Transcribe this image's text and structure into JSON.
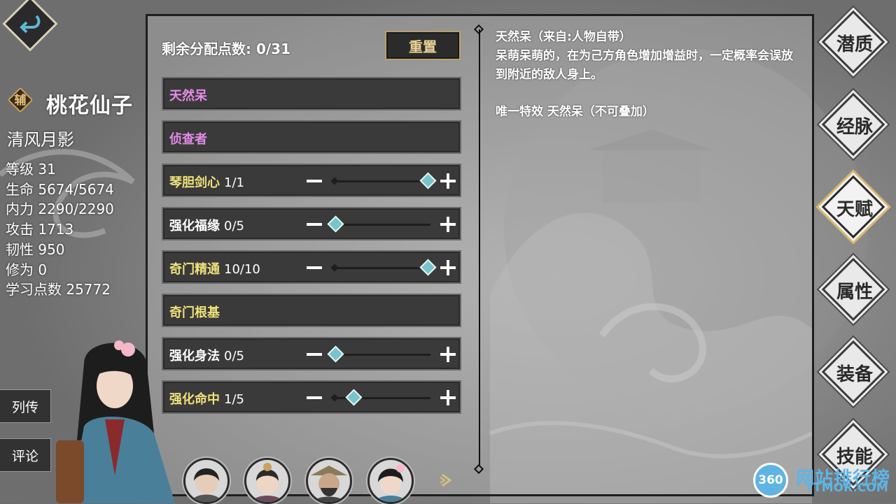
{
  "header": {
    "back_icon": "return-arrow-icon"
  },
  "character": {
    "role_badge": "辅",
    "name": "桃花仙子",
    "title": "清风月影",
    "stats": [
      "等级 31",
      "生命 5674/5674",
      "内力 2290/2290",
      "攻击 1713",
      "韧性 950",
      "修为 0",
      "学习点数 25772"
    ]
  },
  "side_buttons": {
    "biography": "列传",
    "comments": "评论"
  },
  "talent_panel": {
    "remaining_points_label": "剩余分配点数: 0/31",
    "reset_label": "重置",
    "rows": [
      {
        "name": "天然呆",
        "count": "",
        "color": "#e58be8",
        "has_slider": false
      },
      {
        "name": "侦查者",
        "count": "",
        "color": "#e58be8",
        "has_slider": false
      },
      {
        "name": "琴胆剑心",
        "count": "1/1",
        "color": "#eee07b",
        "has_slider": true,
        "level": 1.0
      },
      {
        "name": "强化福缘",
        "count": "0/5",
        "color": "#ffffff",
        "has_slider": true,
        "level": 0.0
      },
      {
        "name": "奇门精通",
        "count": "10/10",
        "color": "#eee07b",
        "has_slider": true,
        "level": 1.0
      },
      {
        "name": "奇门根基",
        "count": "",
        "color": "#eee07b",
        "has_slider": false
      },
      {
        "name": "强化身法",
        "count": "0/5",
        "color": "#ffffff",
        "has_slider": true,
        "level": 0.0
      },
      {
        "name": "强化命中",
        "count": "1/5",
        "color": "#eee07b",
        "has_slider": true,
        "level": 0.2
      }
    ]
  },
  "description": {
    "title": "天然呆（来自:人物自带）",
    "body": "呆萌呆萌的，在为己方角色增加增益时，一定概率会误放到附近的敌人身上。",
    "effect": "唯一特效 天然呆（不可叠加）"
  },
  "nav_tabs": [
    {
      "label": "潜质",
      "active": false
    },
    {
      "label": "经脉",
      "active": false
    },
    {
      "label": "天赋",
      "active": true
    },
    {
      "label": "属性",
      "active": false
    },
    {
      "label": "装备",
      "active": false
    },
    {
      "label": "技能",
      "active": false
    }
  ],
  "watermark": {
    "logo": "360",
    "text": "网站排行榜",
    "url": "TTMOR.COM"
  },
  "colors": {
    "pink": "#e58be8",
    "yellow": "#eee07b",
    "knob": "#77c4cc",
    "reset_border": "#b9a06a"
  }
}
